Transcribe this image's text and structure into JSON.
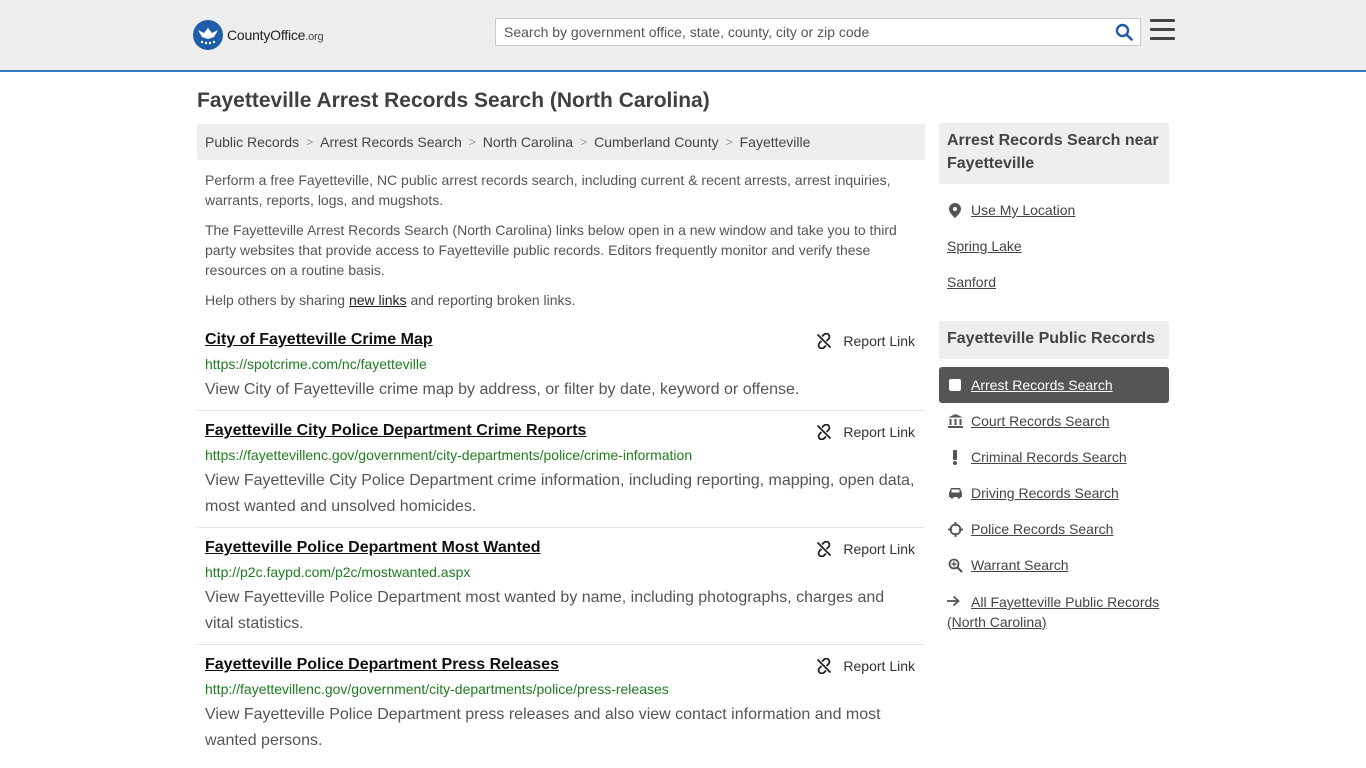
{
  "header": {
    "logo_text_main": "CountyOffice",
    "logo_text_tld": ".org",
    "search_placeholder": "Search by government office, state, county, city or zip code"
  },
  "page": {
    "title": "Fayetteville Arrest Records Search (North Carolina)"
  },
  "breadcrumb": [
    "Public Records",
    "Arrest Records Search",
    "North Carolina",
    "Cumberland County",
    "Fayetteville"
  ],
  "intro": {
    "p1": "Perform a free Fayetteville, NC public arrest records search, including current & recent arrests, arrest inquiries, warrants, reports, logs, and mugshots.",
    "p2": "The Fayetteville Arrest Records Search (North Carolina) links below open in a new window and take you to third party websites that provide access to Fayetteville public records. Editors frequently monitor and verify these resources on a routine basis.",
    "p3_before": "Help others by sharing ",
    "p3_link": "new links",
    "p3_after": " and reporting broken links."
  },
  "report_label": "Report Link",
  "results": [
    {
      "title": "City of Fayetteville Crime Map",
      "url": "https://spotcrime.com/nc/fayetteville",
      "desc": "View City of Fayetteville crime map by address, or filter by date, keyword or offense."
    },
    {
      "title": "Fayetteville City Police Department Crime Reports",
      "url": "https://fayettevillenc.gov/government/city-departments/police/crime-information",
      "desc": "View Fayetteville City Police Department crime information, including reporting, mapping, open data, most wanted and unsolved homicides."
    },
    {
      "title": "Fayetteville Police Department Most Wanted",
      "url": "http://p2c.faypd.com/p2c/mostwanted.aspx",
      "desc": "View Fayetteville Police Department most wanted by name, including photographs, charges and vital statistics."
    },
    {
      "title": "Fayetteville Police Department Press Releases",
      "url": "http://fayettevillenc.gov/government/city-departments/police/press-releases",
      "desc": "View Fayetteville Police Department press releases and also view contact information and most wanted persons."
    }
  ],
  "sidebar": {
    "near_title": "Arrest Records Search near Fayetteville",
    "near_links": [
      "Use My Location",
      "Spring Lake",
      "Sanford"
    ],
    "records_title": "Fayetteville Public Records",
    "active_item": "Arrest Records Search",
    "record_links": [
      "Court Records Search",
      "Criminal Records Search",
      "Driving Records Search",
      "Police Records Search",
      "Warrant Search"
    ],
    "all_records": "All Fayetteville Public Records (North Carolina)"
  },
  "colors": {
    "accent": "#3a78b8",
    "url_green": "#1e7d1e",
    "active_bg": "#555555"
  }
}
